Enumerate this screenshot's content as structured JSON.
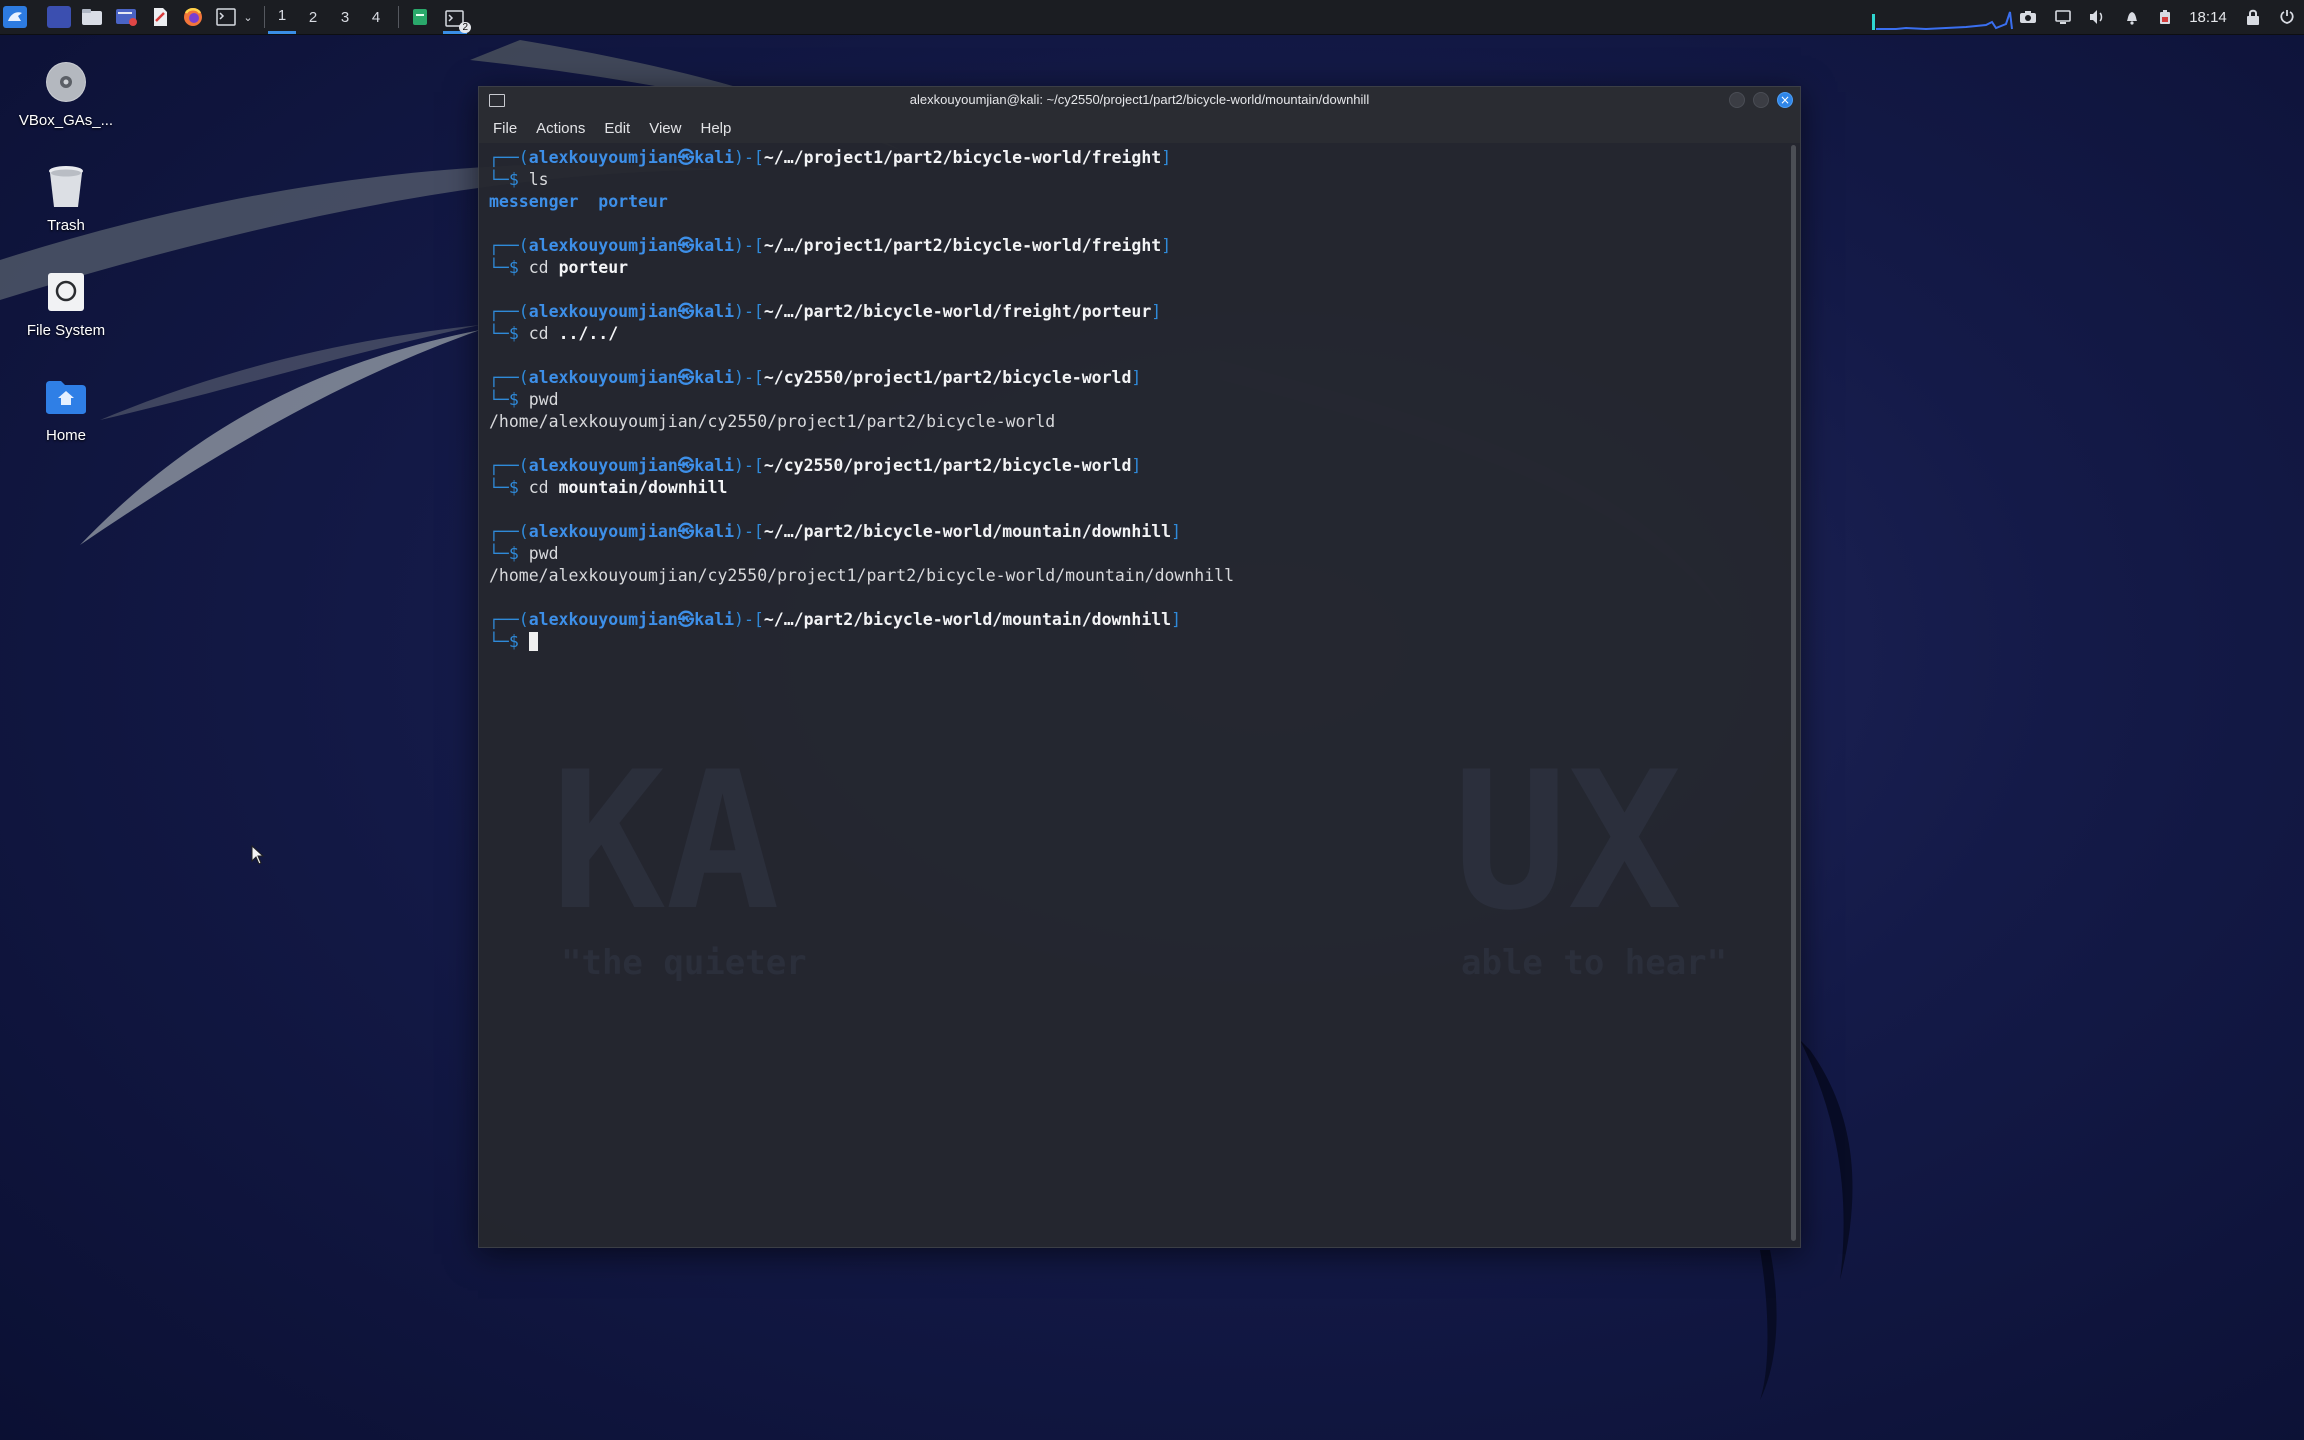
{
  "panel": {
    "workspaces": [
      "1",
      "2",
      "3",
      "4"
    ],
    "active_workspace": "1",
    "clock": "18:14",
    "task_badge": "2"
  },
  "desktop": {
    "icons": [
      {
        "label": "VBox_GAs_...",
        "icon": "disc-icon"
      },
      {
        "label": "Trash",
        "icon": "trash-icon"
      },
      {
        "label": "File System",
        "icon": "drive-icon"
      },
      {
        "label": "Home",
        "icon": "home-folder-icon"
      }
    ],
    "wallpaper_text": [
      "KA",
      "UX",
      "\"the quieter",
      "able to hear\""
    ]
  },
  "window": {
    "title": "alexkouyoumjian@kali: ~/cy2550/project1/part2/bicycle-world/mountain/downhill",
    "menu": [
      "File",
      "Actions",
      "Edit",
      "View",
      "Help"
    ]
  },
  "terminal": {
    "user": "alexkouyoumjian",
    "at": "㉿",
    "host": "kali",
    "prompt_symbol": "$",
    "blocks": [
      {
        "path": "~/…/project1/part2/bicycle-world/freight",
        "cmd": "ls",
        "arg": "",
        "output": "",
        "dirs": [
          "messenger",
          "porteur"
        ]
      },
      {
        "path": "~/…/project1/part2/bicycle-world/freight",
        "cmd": "cd",
        "arg": "porteur",
        "output": ""
      },
      {
        "path": "~/…/part2/bicycle-world/freight/porteur",
        "cmd": "cd",
        "arg": "../../",
        "output": ""
      },
      {
        "path": "~/cy2550/project1/part2/bicycle-world",
        "cmd": "pwd",
        "arg": "",
        "output": "/home/alexkouyoumjian/cy2550/project1/part2/bicycle-world"
      },
      {
        "path": "~/cy2550/project1/part2/bicycle-world",
        "cmd": "cd",
        "arg": "mountain/downhill",
        "output": ""
      },
      {
        "path": "~/…/part2/bicycle-world/mountain/downhill",
        "cmd": "pwd",
        "arg": "",
        "output": "/home/alexkouyoumjian/cy2550/project1/part2/bicycle-world/mountain/downhill"
      },
      {
        "path": "~/…/part2/bicycle-world/mountain/downhill",
        "cmd": "",
        "arg": "",
        "output": ""
      }
    ]
  },
  "colors": {
    "accent": "#2f86e8",
    "terminal_bg": "#25272e",
    "prompt_blue": "#3d8fe8"
  }
}
